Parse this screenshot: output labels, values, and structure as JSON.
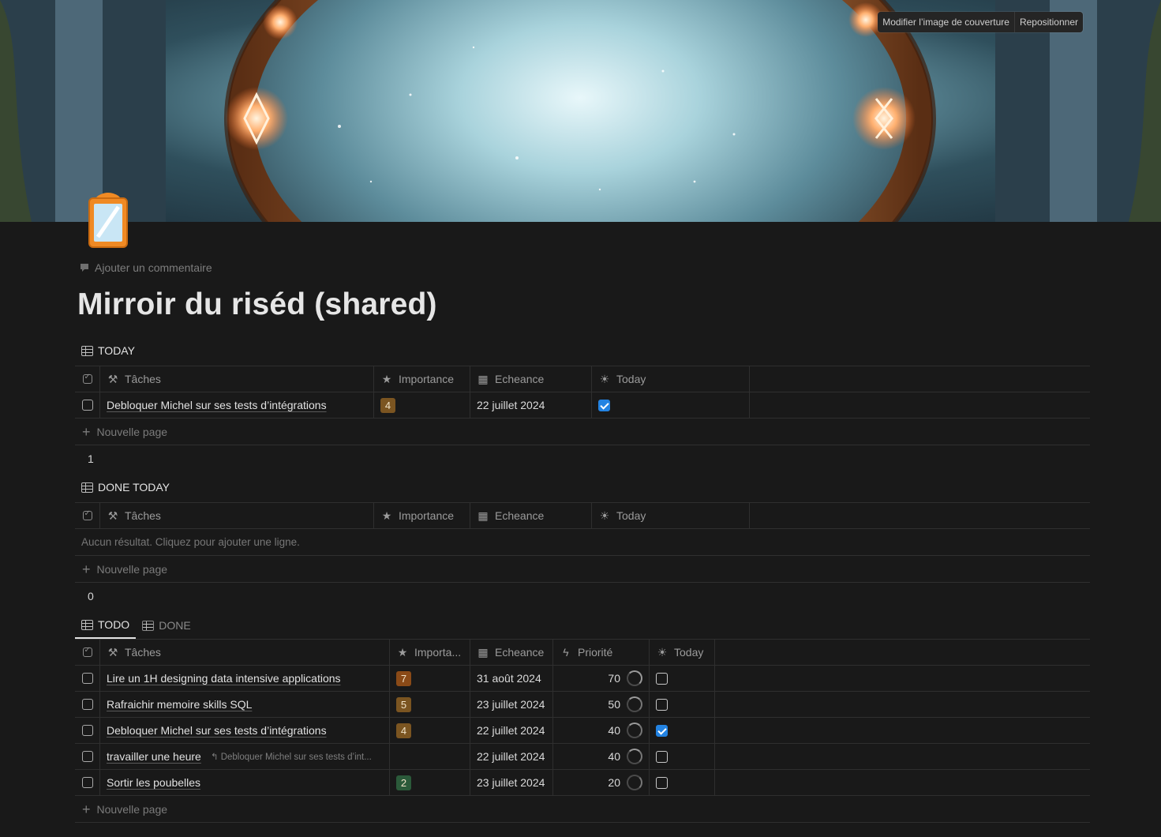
{
  "cover": {
    "change_label": "Modifier l’image de couverture",
    "reposition_label": "Repositionner"
  },
  "comment_label": "Ajouter un commentaire",
  "title": "Mirroir du riséd (shared)",
  "today_view": {
    "title": "TODAY",
    "columns": [
      "Tâches",
      "Importance",
      "Echeance",
      "Today"
    ],
    "rows": [
      {
        "task": "Debloquer Michel sur ses tests d’intégrations",
        "importance": "4",
        "echeance": "22 juillet 2024",
        "today": true
      }
    ],
    "new_page": "Nouvelle page",
    "count": "1"
  },
  "done_today_view": {
    "title": "DONE TODAY",
    "columns": [
      "Tâches",
      "Importance",
      "Echeance",
      "Today"
    ],
    "empty": "Aucun résultat. Cliquez pour ajouter une ligne.",
    "new_page": "Nouvelle page",
    "count": "0"
  },
  "todo_view": {
    "tabs": [
      "TODO",
      "DONE"
    ],
    "columns": [
      "Tâches",
      "Importa...",
      "Echeance",
      "Priorité",
      "Today"
    ],
    "rows": [
      {
        "task": "Lire un 1H designing data intensive applications",
        "sub": "",
        "importance": "7",
        "importance_color": "#8a4a17",
        "echeance": "31 août 2024",
        "priorite": "70",
        "today": false
      },
      {
        "task": "Rafraichir memoire skills SQL",
        "sub": "",
        "importance": "5",
        "importance_color": "#7b5521",
        "echeance": "23 juillet 2024",
        "priorite": "50",
        "today": false
      },
      {
        "task": "Debloquer Michel sur ses tests d’intégrations",
        "sub": "",
        "importance": "4",
        "importance_color": "#7b5521",
        "echeance": "22 juillet 2024",
        "priorite": "40",
        "today": true
      },
      {
        "task": "travailler une heure",
        "sub": "Debloquer Michel sur ses tests d’int...",
        "importance": "",
        "importance_color": "",
        "echeance": "22 juillet 2024",
        "priorite": "40",
        "today": false
      },
      {
        "task": "Sortir les poubelles",
        "sub": "",
        "importance": "2",
        "importance_color": "#2b5a3a",
        "echeance": "23 juillet 2024",
        "priorite": "20",
        "today": false
      }
    ],
    "new_page": "Nouvelle page"
  }
}
